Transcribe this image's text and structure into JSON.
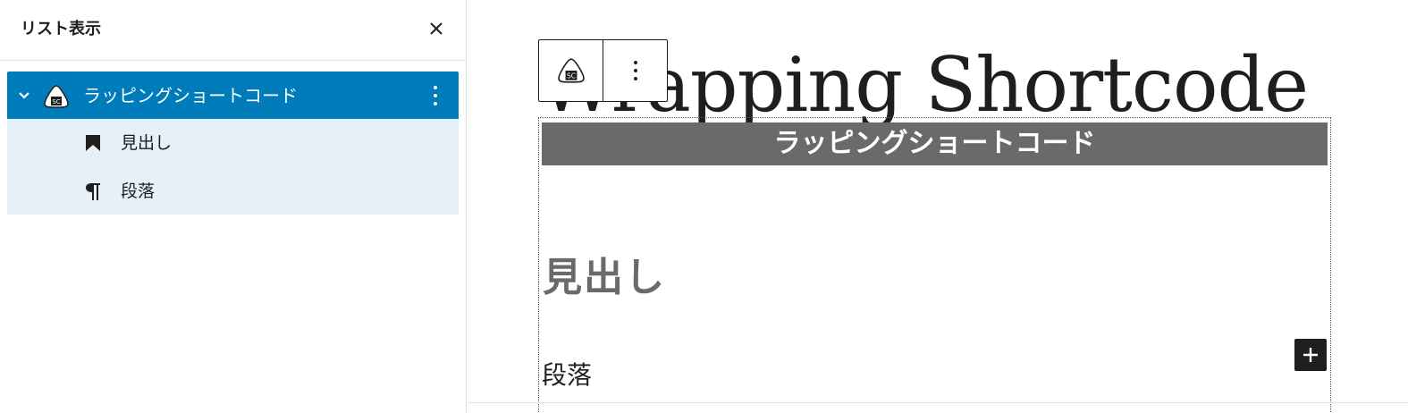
{
  "list_view": {
    "title": "リスト表示",
    "close_icon": "close-icon",
    "items": [
      {
        "label": "ラッピングショートコード",
        "icon": "shortcode-onigiri-icon",
        "selected": true,
        "expanded": true
      },
      {
        "label": "見出し",
        "icon": "bookmark-icon"
      },
      {
        "label": "段落",
        "icon": "pilcrow-icon"
      }
    ]
  },
  "editor": {
    "post_title": "Wrapping Shortcode",
    "toolbar": {
      "block_icon": "shortcode-onigiri-icon",
      "options_icon": "more-vertical-icon"
    },
    "wrap_block": {
      "header": "ラッピングショートコード",
      "heading": "見出し",
      "paragraph": "段落"
    },
    "add_block_icon": "plus-icon"
  },
  "colors": {
    "accent": "#007cba",
    "child_bg": "#e6f0f8",
    "wrap_header_bg": "#6a6a6a",
    "dark": "#1e1e1e"
  }
}
